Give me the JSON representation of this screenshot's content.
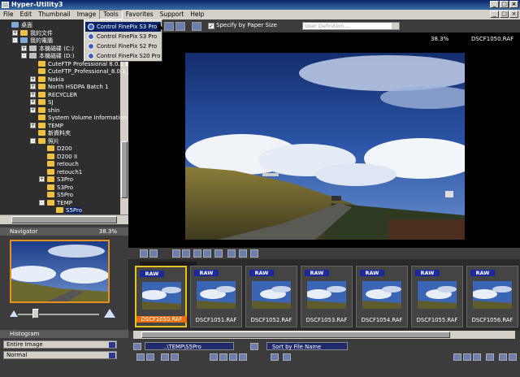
{
  "window": {
    "title": "Hyper-Utility3"
  },
  "menu": [
    "File",
    "Edit",
    "Thumbnail",
    "Image",
    "Tools",
    "Favorites",
    "Support",
    "Help"
  ],
  "tools_menu": [
    "Control FinePix S3 Pro",
    "Control FinePix S3 Pro",
    "Control FinePix S2 Pro",
    "Control FinePix S20 Pro"
  ],
  "tree": [
    {
      "label": "桌面",
      "indent": 0,
      "kind": "pc"
    },
    {
      "label": "我的文件",
      "indent": 1,
      "kind": "folder",
      "exp": "+"
    },
    {
      "label": "我的電腦",
      "indent": 1,
      "kind": "pc",
      "exp": "-"
    },
    {
      "label": "本機磁碟 (C:)",
      "indent": 2,
      "kind": "drive",
      "exp": "+"
    },
    {
      "label": "本機磁碟 (D:)",
      "indent": 2,
      "kind": "drive",
      "exp": "-"
    },
    {
      "label": "CuteFTP Professional 8.0.1 Build",
      "indent": 3,
      "kind": "folder"
    },
    {
      "label": "CuteFTP_Professional_8.0.1_Bui",
      "indent": 3,
      "kind": "folder"
    },
    {
      "label": "Nokia",
      "indent": 3,
      "kind": "folder",
      "exp": "+"
    },
    {
      "label": "North HSDPA Batch 1",
      "indent": 3,
      "kind": "folder",
      "exp": "+"
    },
    {
      "label": "RECYCLER",
      "indent": 3,
      "kind": "folder",
      "exp": "+"
    },
    {
      "label": "SJ",
      "indent": 3,
      "kind": "folder",
      "exp": "+"
    },
    {
      "label": "shin",
      "indent": 3,
      "kind": "folder",
      "exp": "+"
    },
    {
      "label": "System Volume Information",
      "indent": 3,
      "kind": "folder"
    },
    {
      "label": "TEMP",
      "indent": 3,
      "kind": "folder",
      "exp": "+"
    },
    {
      "label": "新資料夾",
      "indent": 3,
      "kind": "folder"
    },
    {
      "label": "照片",
      "indent": 3,
      "kind": "folder",
      "exp": "-"
    },
    {
      "label": "D200",
      "indent": 4,
      "kind": "folder"
    },
    {
      "label": "D200 II",
      "indent": 4,
      "kind": "folder"
    },
    {
      "label": "retouch",
      "indent": 4,
      "kind": "folder"
    },
    {
      "label": "retouch1",
      "indent": 4,
      "kind": "folder"
    },
    {
      "label": "S3Pro",
      "indent": 4,
      "kind": "folder",
      "exp": "+"
    },
    {
      "label": "S3Pro",
      "indent": 4,
      "kind": "folder"
    },
    {
      "label": "S5Pro",
      "indent": 4,
      "kind": "folder"
    },
    {
      "label": "TEMP",
      "indent": 4,
      "kind": "folder",
      "exp": "-"
    },
    {
      "label": "S5Pro",
      "indent": 5,
      "kind": "folder",
      "selected": true
    }
  ],
  "navigator": {
    "title": "Navigator",
    "zoom": "38.3%"
  },
  "histogram": {
    "title": "Histogram",
    "channel": "Entire Image",
    "mode": "Normal"
  },
  "toolbar": {
    "checkbox_label": "Specify by Paper Size",
    "checked": true,
    "combo_value": "User Definition..."
  },
  "viewer": {
    "zoom": "38.3%",
    "filename": "DSCF1050.RAF"
  },
  "thumbnails": [
    {
      "name": "DSCF1050.RAF",
      "badge": "RAW",
      "selected": true
    },
    {
      "name": "DSCF1051.RAF",
      "badge": "RAW",
      "selected": false
    },
    {
      "name": "DSCF1052.RAF",
      "badge": "RAW",
      "selected": false
    },
    {
      "name": "DSCF1053.RAF",
      "badge": "RAW",
      "selected": false
    },
    {
      "name": "DSCF1054.RAF",
      "badge": "RAW",
      "selected": false
    },
    {
      "name": "DSCF1055.RAF",
      "badge": "RAW",
      "selected": false
    },
    {
      "name": "DSCF1056.RAF",
      "badge": "RAW",
      "selected": false
    }
  ],
  "status": {
    "path": "..\\TEMP\\S5Pro",
    "sort": "Sort by File Name"
  },
  "colors": {
    "selection": "#0a246a",
    "thumb_highlight": "#e8c020",
    "raw_badge": "#1a2a9c",
    "nav_frame": "#e8901c"
  }
}
